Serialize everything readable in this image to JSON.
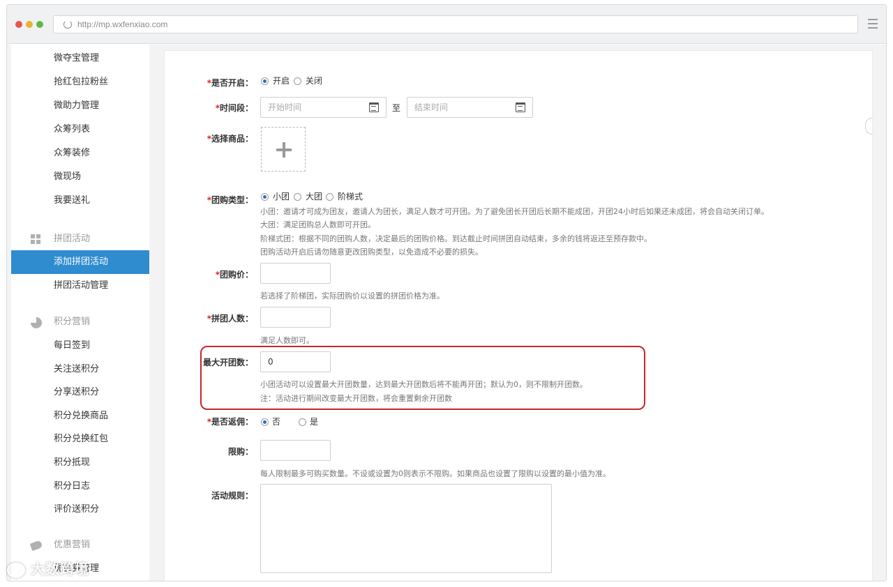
{
  "browser": {
    "url": "http://mp.wxfenxiao.com"
  },
  "sidebar": {
    "items_top": [
      {
        "label": "微夺宝管理"
      },
      {
        "label": "抢红包拉粉丝"
      },
      {
        "label": "微助力管理"
      },
      {
        "label": "众筹列表"
      },
      {
        "label": "众筹装修"
      },
      {
        "label": "微现场"
      },
      {
        "label": "我要送礼"
      }
    ],
    "group_pintuan": {
      "label": "拼团活动",
      "icon": "grid-icon"
    },
    "items_pintuan": [
      {
        "label": "添加拼团活动",
        "active": true
      },
      {
        "label": "拼团活动管理"
      }
    ],
    "group_points": {
      "label": "积分营销",
      "icon": "pie-icon"
    },
    "items_points": [
      {
        "label": "每日签到"
      },
      {
        "label": "关注送积分"
      },
      {
        "label": "分享送积分"
      },
      {
        "label": "积分兑换商品"
      },
      {
        "label": "积分兑换红包"
      },
      {
        "label": "积分抵现"
      },
      {
        "label": "积分日志"
      },
      {
        "label": "评价送积分"
      }
    ],
    "group_coupon": {
      "label": "优惠营销",
      "icon": "tag-icon"
    },
    "items_coupon": [
      {
        "label": "优惠券管理"
      }
    ]
  },
  "watermark": {
    "text": "大数跨境"
  },
  "form": {
    "enable": {
      "label": "是否开启：",
      "required": true,
      "options": [
        "开启",
        "关闭"
      ],
      "selected": "开启"
    },
    "period": {
      "label": "时间段：",
      "required": true,
      "start_placeholder": "开始时间",
      "end_placeholder": "结束时间",
      "separator": "至"
    },
    "product": {
      "label": "选择商品：",
      "required": true
    },
    "group_type": {
      "label": "团购类型：",
      "required": true,
      "options": [
        "小团",
        "大团",
        "阶梯式"
      ],
      "selected": "小团",
      "help": [
        "小团：邀请才可成为团友，邀请人为团长，满足人数才可开团。为了避免团长开团后长期不能成团，开团24小时后如果还未成团，将会自动关闭订单。",
        "大团：满足团购总人数即可开团。",
        "阶梯式团：根据不同的团购人数，决定最后的团购价格。到达截止时间拼团自动结束，多余的钱将返还至预存款中。",
        "团购活动开启后请勿随意更改团购类型，以免造成不必要的损失。"
      ]
    },
    "group_price": {
      "label": "团购价：",
      "required": true,
      "value": "",
      "help": "若选择了阶梯团，实际团购价以设置的拼团价格为准。"
    },
    "group_size": {
      "label": "拼团人数：",
      "required": true,
      "value": "",
      "help": "满足人数即可。"
    },
    "max_groups": {
      "label": "最大开团数：",
      "required": false,
      "value": "0",
      "help": [
        "小团活动可以设置最大开团数量，达到最大开团数后将不能再开团；默认为0，则不限制开团数。",
        "注：活动进行期间改变最大开团数，将会重置剩余开团数"
      ]
    },
    "rebate": {
      "label": "是否返佣：",
      "required": true,
      "options": [
        "否",
        "是"
      ],
      "selected": "否"
    },
    "limit": {
      "label": "限购：",
      "required": false,
      "value": "",
      "help": "每人限制最多可购买数量。不设或设置为0则表示不限购。如果商品也设置了限购以设置的最小值为准。"
    },
    "rules": {
      "label": "活动规则：",
      "required": false,
      "value": ""
    }
  },
  "colors": {
    "accent": "#2e8ccf",
    "required": "#e02020",
    "highlight": "#c8242a"
  }
}
